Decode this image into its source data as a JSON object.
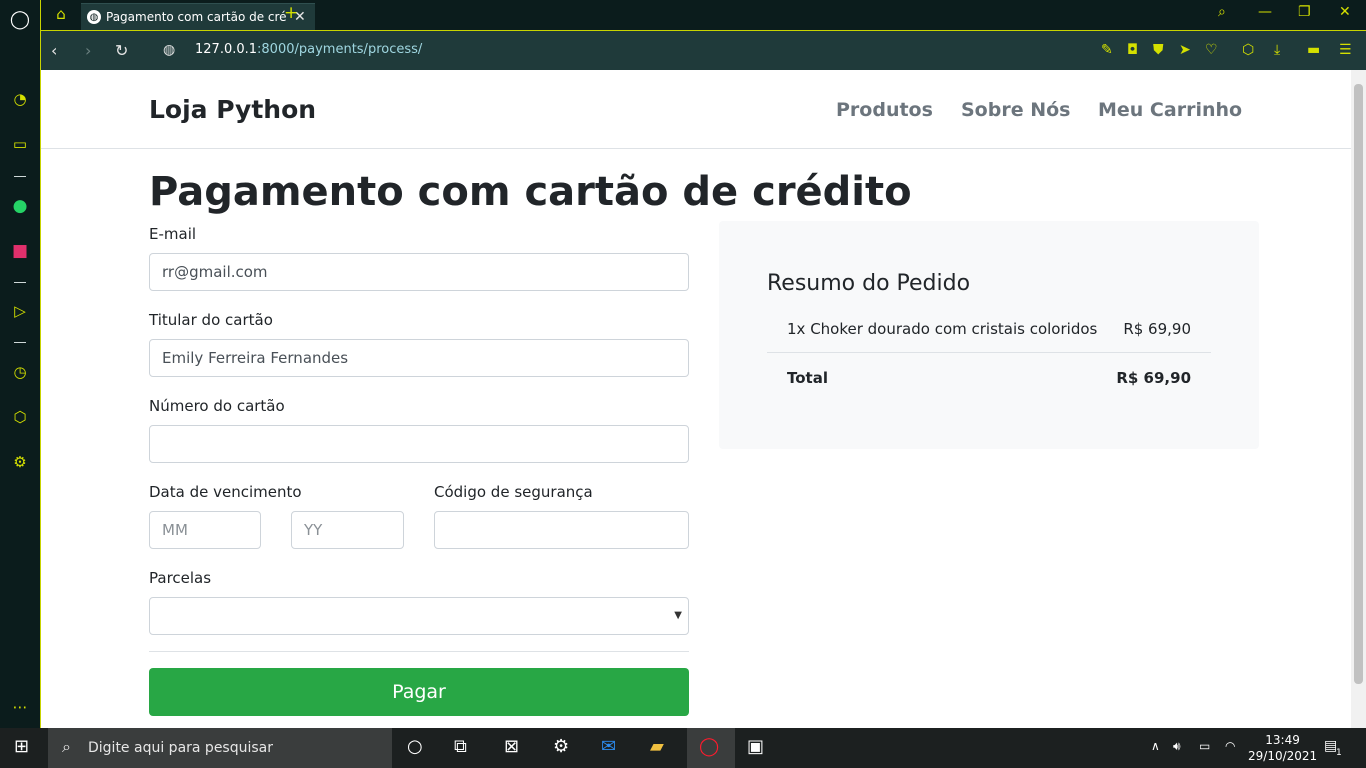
{
  "browser": {
    "tab_title": "Pagamento com cartão de crédito",
    "url_host": "127.0.0.1",
    "url_rest": ":8000/payments/process/"
  },
  "site": {
    "brand": "Loja Python",
    "nav": [
      "Produtos",
      "Sobre Nós",
      "Meu Carrinho"
    ]
  },
  "form": {
    "heading": "Pagamento com cartão de crédito",
    "email_label": "E-mail",
    "email_value": "rr@gmail.com",
    "holder_label": "Titular do cartão",
    "holder_value": "Emily Ferreira Fernandes",
    "number_label": "Número do cartão",
    "number_value": "",
    "expiry_label": "Data de vencimento",
    "month_placeholder": "MM",
    "year_placeholder": "YY",
    "cvv_label": "Código de segurança",
    "installments_label": "Parcelas",
    "installments_value": "",
    "submit_label": "Pagar"
  },
  "summary": {
    "title": "Resumo do Pedido",
    "item": "1x Choker dourado com cristais coloridos",
    "item_price": "R$ 69,90",
    "total_label": "Total",
    "total_value": "R$ 69,90"
  },
  "taskbar": {
    "search_placeholder": "Digite aqui para pesquisar",
    "time": "13:49",
    "date": "29/10/2021",
    "notif_count": "1"
  }
}
